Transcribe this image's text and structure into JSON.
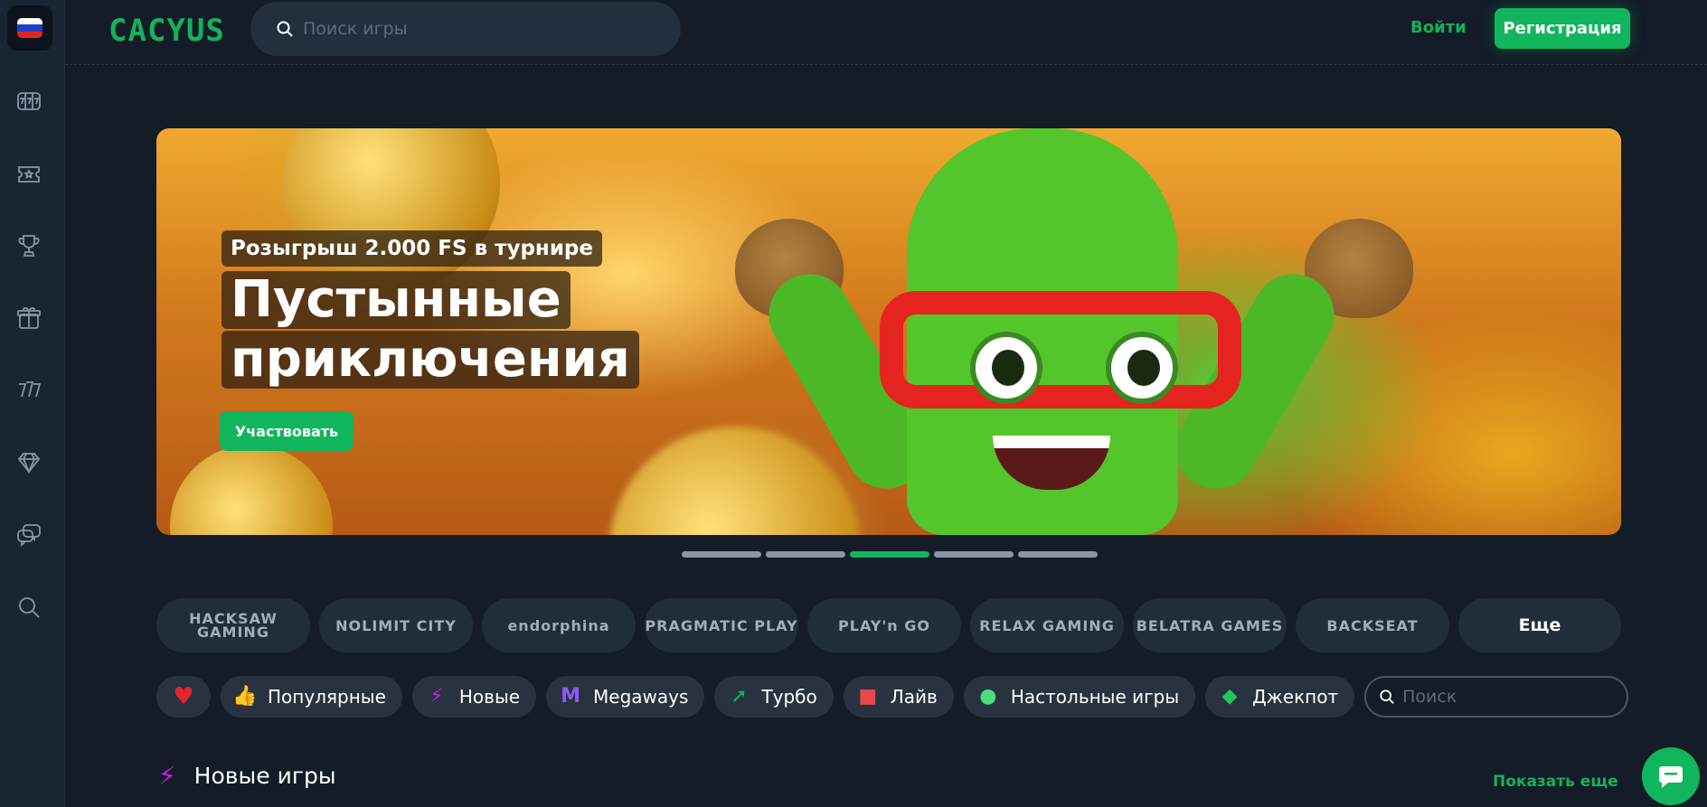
{
  "language": {
    "flag_colors": [
      "#ffffff",
      "#1c3fc7",
      "#e0251f"
    ]
  },
  "sidebar": {
    "items": [
      {
        "icon": "slots-icon"
      },
      {
        "icon": "ticket-icon"
      },
      {
        "icon": "trophy-icon"
      },
      {
        "icon": "gift-icon"
      },
      {
        "icon": "sevens-icon"
      },
      {
        "icon": "diamond-icon"
      },
      {
        "icon": "chat-bubbles-icon"
      },
      {
        "icon": "search-icon"
      }
    ]
  },
  "header": {
    "logo": "CACYUS",
    "search_placeholder": "Поиск игры",
    "login_label": "Войти",
    "register_label": "Регистрация"
  },
  "banner": {
    "subtitle": "Розыгрыш 2.000 FS в турнире",
    "title_line1": "Пустынные",
    "title_line2": "приключения",
    "cta_label": "Участвовать"
  },
  "carousel": {
    "slides": 5,
    "active_index": 2
  },
  "providers": {
    "items": [
      "HACKSAW GAMING",
      "NOLIMIT CITY",
      "endorphina",
      "PRAGMATIC PLAY",
      "PLAY'n GO",
      "RELAX GAMING",
      "BELATRA GAMES",
      "BACKSEAT"
    ],
    "more_label": "Еще"
  },
  "categories": {
    "items": [
      {
        "label": "Популярные",
        "icon": "thumbs-up-icon",
        "color": "#f7c31c"
      },
      {
        "label": "Новые",
        "icon": "lightning-icon",
        "color": "#c71ee8"
      },
      {
        "label": "Megaways",
        "icon": "megaways-icon",
        "color": "#8b5cf6"
      },
      {
        "label": "Турбо",
        "icon": "rocket-icon",
        "color": "#11b55d"
      },
      {
        "label": "Лайв",
        "icon": "live-camera-icon",
        "color": "#e5484d"
      },
      {
        "label": "Настольные игры",
        "icon": "table-games-icon",
        "color": "#4ade80"
      },
      {
        "label": "Джекпот",
        "icon": "jackpot-diamond-icon",
        "color": "#22c55e"
      }
    ],
    "search_placeholder": "Поиск"
  },
  "section": {
    "title": "Новые игры",
    "show_more_label": "Показать еще"
  },
  "colors": {
    "accent": "#11b55d",
    "background": "#131c27",
    "sidebar": "#1a2532"
  }
}
